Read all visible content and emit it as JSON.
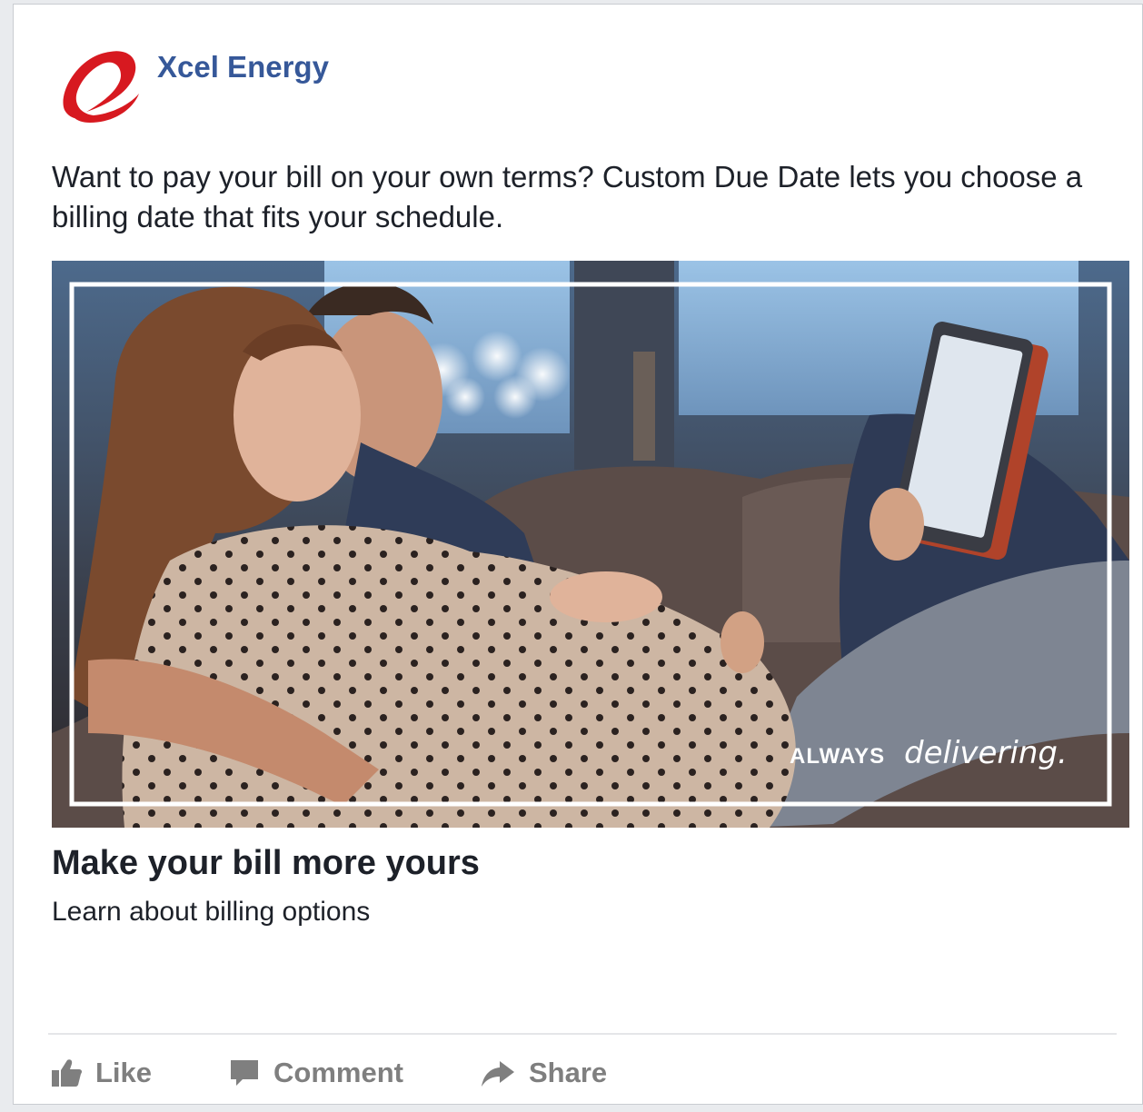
{
  "post": {
    "page_name": "Xcel Energy",
    "text": "Want to pay your bill on your own terms? Custom Due Date lets you choose a billing date that fits your schedule.",
    "image": {
      "overlay_prefix": "ALWAYS",
      "overlay_emphasis": "delivering."
    },
    "link_title": "Make your bill more yours",
    "link_description": "Learn about billing options"
  },
  "actions": {
    "like": "Like",
    "comment": "Comment",
    "share": "Share"
  },
  "colors": {
    "brand_red": "#d71920",
    "page_name_blue": "#365899",
    "action_gray": "#7f7f7f"
  },
  "icons": [
    "xcel-logo-icon",
    "thumbs-up-icon",
    "comment-icon",
    "share-arrow-icon"
  ]
}
